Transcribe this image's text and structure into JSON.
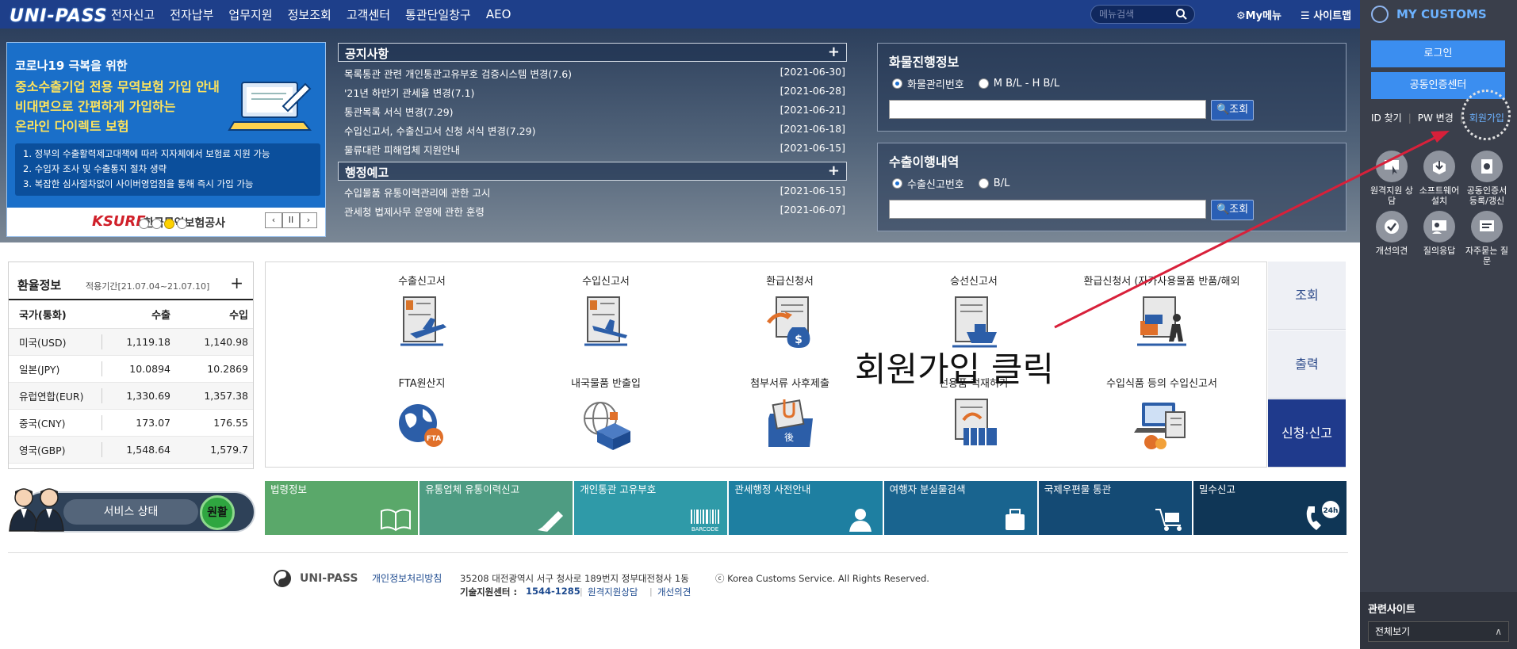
{
  "brand": {
    "logo_text": "UNI-PASS"
  },
  "nav": {
    "items": [
      "전자신고",
      "전자납부",
      "업무지원",
      "정보조회",
      "고객센터",
      "통관단일창구",
      "AEO"
    ],
    "search_placeholder": "메뉴검색",
    "my_menu": "My메뉴",
    "sitemap": "사이트맵"
  },
  "banner": {
    "line1": "코로나19 극복을 위한",
    "line2": "중소수출기업 전용 무역보험 가입 안내",
    "line3": "비대면으로 간편하게 가입하는",
    "line4": "온라인 다이렉트 보험",
    "bullets": [
      "1. 정부의 수출활력제고대책에 따라 지자체에서 보험료 지원 가능",
      "2. 수입자 조사 및 수출통지 절차 생략",
      "3. 복잡한 심사절차없이 사이버영업점을 통해 즉시 가입 가능"
    ],
    "ksure": "KSURE",
    "ksure_kr": "한국무역보험공사",
    "pause": "II"
  },
  "notices": {
    "title": "공지사항",
    "items": [
      {
        "title": "목록통관 관련 개인통관고유부호 검증시스템 변경(7.6)",
        "date": "[2021-06-30]"
      },
      {
        "title": "'21년 하반기 관세율 변경(7.1)",
        "date": "[2021-06-28]"
      },
      {
        "title": "통관목록 서식 변경(7.29)",
        "date": "[2021-06-21]"
      },
      {
        "title": "수입신고서, 수출신고서 신청 서식 변경(7.29)",
        "date": "[2021-06-18]"
      },
      {
        "title": "물류대란 피해업체 지원안내",
        "date": "[2021-06-15]"
      }
    ]
  },
  "admin": {
    "title": "행정예고",
    "items": [
      {
        "title": "수입물품 유통이력관리에 관한 고시",
        "date": "[2021-06-15]"
      },
      {
        "title": "관세청 법제사무 운영에 관한 훈령",
        "date": "[2021-06-07]"
      }
    ]
  },
  "cargo": {
    "title": "화물진행정보",
    "opt1": "화물관리번호",
    "opt2": "M B/L - H B/L",
    "btn": "조회"
  },
  "export_hist": {
    "title": "수출이행내역",
    "opt1": "수출신고번호",
    "opt2": "B/L",
    "btn": "조회"
  },
  "rates": {
    "title": "환율정보",
    "period": "적용기간[21.07.04~21.07.10]",
    "headers": [
      "국가(통화)",
      "수출",
      "수입"
    ],
    "rows": [
      {
        "country": "미국(USD)",
        "export": "1,119.18",
        "import": "1,140.98"
      },
      {
        "country": "일본(JPY)",
        "export": "10.0894",
        "import": "10.2869"
      },
      {
        "country": "유럽연합(EUR)",
        "export": "1,330.69",
        "import": "1,357.38"
      },
      {
        "country": "중국(CNY)",
        "export": "173.07",
        "import": "176.55"
      },
      {
        "country": "영국(GBP)",
        "export": "1,548.64",
        "import": "1,579.7"
      }
    ]
  },
  "service": {
    "label": "서비스 상태",
    "status": "원활"
  },
  "tiles": {
    "row1": [
      "수출신고서",
      "수입신고서",
      "환급신청서",
      "승선신고서",
      "환급신청서 (자가사용물품 반품/해외"
    ],
    "row2": [
      "FTA원산지",
      "내국물품 반출입",
      "첨부서류 사후제출",
      "선용품 적재허가",
      "수입식품 등의 수입신고서"
    ]
  },
  "side_tabs": [
    "조회",
    "출력",
    "신청·신고"
  ],
  "overlay": "회원가입 클릭",
  "quicklinks": [
    {
      "label": "법령정보",
      "color": "#5aa86a"
    },
    {
      "label": "유통업체 유통이력신고",
      "color": "#4e9c82"
    },
    {
      "label": "개인통관 고유부호",
      "color": "#2f9aa8"
    },
    {
      "label": "관세행정 사전안내",
      "color": "#1e7fa1"
    },
    {
      "label": "여행자 분실물검색",
      "color": "#19648f"
    },
    {
      "label": "국제우편물 통관",
      "color": "#144a74"
    },
    {
      "label": "밀수신고",
      "color": "#0f3656"
    }
  ],
  "footer": {
    "brand": "UNI-PASS",
    "privacy": "개인정보처리방침",
    "address": "35208 대전광역시 서구 청사로 189번지 정부대전청사 1동",
    "copyright": "ⓒ Korea Customs Service. All Rights Reserved.",
    "tech_label": "기술지원센터 :",
    "tech_tel": "1544-1285",
    "remote": "원격지원상담",
    "improve": "개선의견"
  },
  "sidebar": {
    "title": "MY CUSTOMS",
    "login": "로그인",
    "cert": "공동인증센터",
    "id_find": "ID 찾기",
    "pw_change": "PW 변경",
    "join": "회원가입",
    "icons": [
      {
        "label": "원격지원 상담",
        "icon": "remote-support-icon"
      },
      {
        "label": "소프트웨어 설치",
        "icon": "software-install-icon"
      },
      {
        "label": "공동인증서 등록/갱신",
        "icon": "certificate-icon"
      },
      {
        "label": "개선의견",
        "icon": "feedback-icon"
      },
      {
        "label": "질의응답",
        "icon": "qna-icon"
      },
      {
        "label": "자주묻는 질문",
        "icon": "faq-icon"
      }
    ],
    "related_title": "관련사이트",
    "related_select": "전체보기"
  },
  "colors": {
    "nav_bg": "#1e3f8a",
    "sidebar_bg": "#3a3f4b",
    "accent_blue": "#3b8ef0",
    "status_green": "#2fa640"
  }
}
